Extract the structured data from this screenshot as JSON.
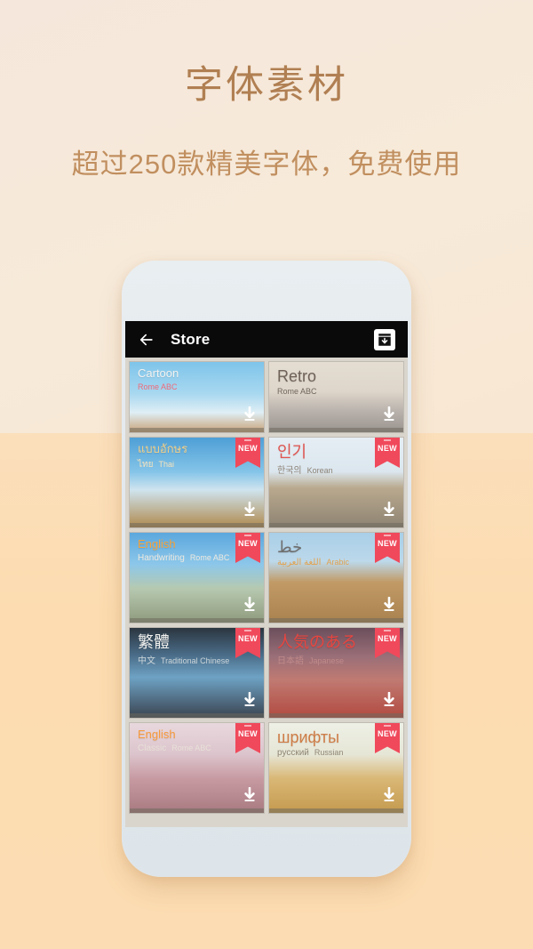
{
  "promo": {
    "title": "字体素材",
    "subtitle": "超过250款精美字体，免费使用",
    "title_color": "#b07f52",
    "subtitle_color": "#c18f5f",
    "background_top_color": "#f6e9dd",
    "background_bottom_color": "#fcdcb3"
  },
  "app": {
    "appbar": {
      "title": "Store",
      "back_icon": "back-arrow-icon",
      "action_icon": "download-box-icon",
      "background_color": "#0a0a0a",
      "text_color": "#ffffff"
    },
    "screen_background_color": "#d9d5cd",
    "badge_label": "NEW",
    "badge_color": "#f0495b",
    "cards": [
      {
        "main": "Cartoon",
        "main_color": "#f4f2ef",
        "sub_native": "",
        "sub_latin": "Rome ABC",
        "sub_color": "#ef6a7a",
        "new": false,
        "download": true,
        "art": "rollercoaster-blue-sky"
      },
      {
        "main": "Retro",
        "main_color": "#6f6258",
        "sub_native": "",
        "sub_latin": "Rome ABC",
        "sub_color": "#70655c",
        "new": false,
        "download": true,
        "art": "eiffel-tower-sepia"
      },
      {
        "main": "แบบอักษร",
        "main_color": "#f3d08a",
        "sub_native": "ไทย",
        "sub_latin": "Thai",
        "sub_color": "#f7e3bd",
        "new": true,
        "download": true,
        "art": "thai-temple-blue-sky"
      },
      {
        "main": "인기",
        "main_color": "#e0544f",
        "sub_native": "한국의",
        "sub_latin": "Korean",
        "sub_color": "#8d8276",
        "new": true,
        "download": true,
        "art": "korean-hanok-house"
      },
      {
        "main": "English",
        "main_color": "#f8a43a",
        "sub_native": "Handwriting",
        "sub_latin": "Rome ABC",
        "sub_color": "#efe9df",
        "new": true,
        "download": true,
        "art": "german-castle-blue-sky"
      },
      {
        "main": "خط",
        "main_color": "#6f6f6f",
        "sub_native": "اللغة العربية",
        "sub_latin": "Arabic",
        "sub_color": "#e2a24f",
        "new": true,
        "download": true,
        "art": "arabic-fort-sandstone"
      },
      {
        "main": "繁體",
        "main_color": "#f0f0ee",
        "sub_native": "中文",
        "sub_latin": "Traditional Chinese",
        "sub_color": "#cdd6da",
        "new": true,
        "download": true,
        "art": "skyscrapers-looking-up"
      },
      {
        "main": "人気のある",
        "main_color": "#e8453f",
        "sub_native": "日本語",
        "sub_latin": "Japanese",
        "sub_color": "#c08a8a",
        "new": true,
        "download": true,
        "art": "japanese-torii-sakura"
      },
      {
        "main": "English",
        "main_color": "#f79a3c",
        "sub_native": "Classic",
        "sub_latin": "Rome ABC",
        "sub_color": "#e7e0d8",
        "new": true,
        "download": true,
        "art": "gothic-cathedral-pink"
      },
      {
        "main": "шрифты",
        "main_color": "#cf7d47",
        "sub_native": "русский",
        "sub_latin": "Russian",
        "sub_color": "#8f8573",
        "new": true,
        "download": true,
        "art": "milan-duomo-golden"
      }
    ]
  }
}
